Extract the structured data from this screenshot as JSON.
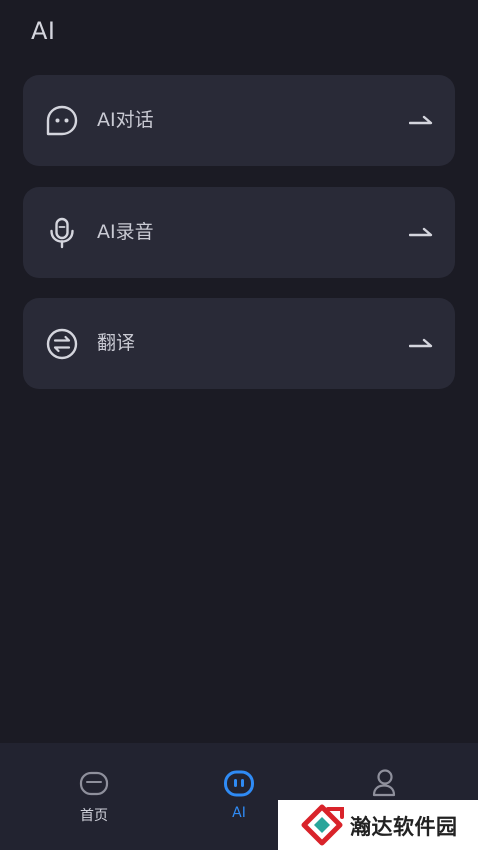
{
  "header": {
    "title": "AI"
  },
  "cards": [
    {
      "label": "AI对话",
      "icon": "chat-bubble-icon"
    },
    {
      "label": "AI录音",
      "icon": "microphone-icon"
    },
    {
      "label": "翻译",
      "icon": "swap-arrows-icon"
    }
  ],
  "tabbar": {
    "tabs": [
      {
        "label": "首页",
        "icon": "home-icon",
        "active": false
      },
      {
        "label": "AI",
        "icon": "ai-bot-icon",
        "active": true
      },
      {
        "label": "",
        "icon": "profile-icon",
        "active": false
      }
    ]
  },
  "watermark": {
    "text": "瀚达软件园"
  },
  "colors": {
    "background": "#1b1b24",
    "card": "#292a37",
    "tabbar": "#222330",
    "accent": "#2f8bf5",
    "text": "#c9cad3",
    "watermark_red": "#d9232a",
    "watermark_teal": "#2aa59a"
  }
}
